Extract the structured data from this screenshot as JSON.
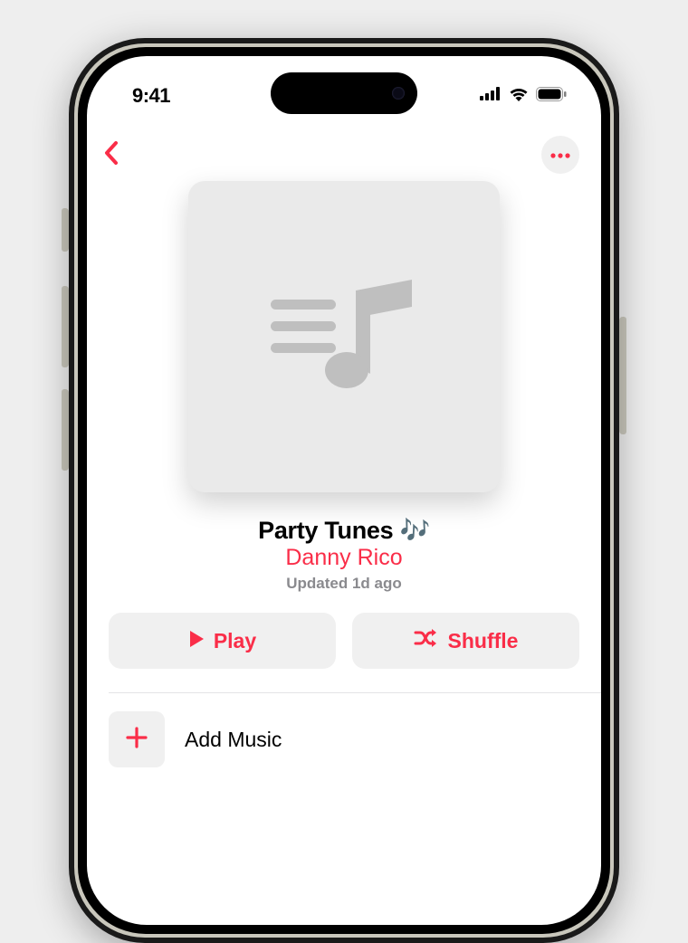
{
  "status": {
    "time": "9:41"
  },
  "playlist": {
    "title": "Party Tunes 🎶",
    "author": "Danny Rico",
    "updated": "Updated 1d ago"
  },
  "actions": {
    "play": "Play",
    "shuffle": "Shuffle"
  },
  "add_music": {
    "label": "Add Music"
  },
  "colors": {
    "accent": "#fa2d48"
  }
}
